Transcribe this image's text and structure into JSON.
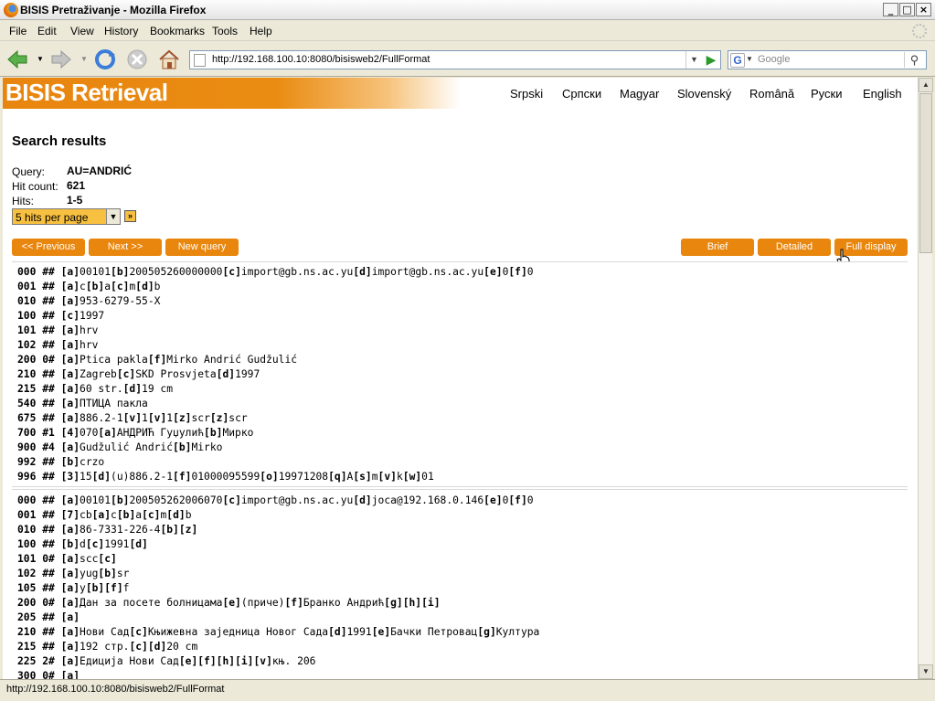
{
  "window": {
    "title": "BISIS Pretraživanje - Mozilla Firefox"
  },
  "menu": [
    "File",
    "Edit",
    "View",
    "History",
    "Bookmarks",
    "Tools",
    "Help"
  ],
  "address": {
    "url": "http://192.168.100.10:8080/bisisweb2/FullFormat"
  },
  "search": {
    "engine": "G",
    "placeholder": "Google"
  },
  "status": {
    "text": "http://192.168.100.10:8080/bisisweb2/FullFormat"
  },
  "site": {
    "logo": "BISIS Retrieval",
    "languages": [
      "Srpski",
      "Српски",
      "Magyar",
      "Slovenský",
      "Română",
      "Руски",
      "English"
    ]
  },
  "results": {
    "heading": "Search results",
    "query_label": "Query:",
    "query": "AU=ANDRIĆ",
    "hitcount_label": "Hit count:",
    "hitcount": "621",
    "hits_label": "Hits:",
    "hits": "1-5",
    "per_page": "5 hits per page"
  },
  "buttons": {
    "previous": "<< Previous",
    "next": "Next >>",
    "new_query": "New query",
    "brief": "Brief",
    "detailed": "Detailed",
    "full": "Full display"
  },
  "records": [
    [
      [
        "000 ##",
        "[a]00101[b]200505260000000[c]import@gb.ns.ac.yu[d]import@gb.ns.ac.yu[e]0[f]0"
      ],
      [
        "001 ##",
        "[a]c[b]a[c]m[d]b"
      ],
      [
        "010 ##",
        "[a]953-6279-55-X"
      ],
      [
        "100 ##",
        "[c]1997"
      ],
      [
        "101 ##",
        "[a]hrv"
      ],
      [
        "102 ##",
        "[a]hrv"
      ],
      [
        "200 0#",
        "[a]Ptica pakla[f]Mirko Andrić Gudžulić"
      ],
      [
        "210 ##",
        "[a]Zagreb[c]SKD Prosvjeta[d]1997"
      ],
      [
        "215 ##",
        "[a]60 str.[d]19 cm"
      ],
      [
        "540 ##",
        "[a]ПТИЦА пакла"
      ],
      [
        "675 ##",
        "[a]886.2-1[v]1[v]1[z]scr[z]scr"
      ],
      [
        "700 #1",
        "[4]070[a]АНДРИЋ Гуџулић[b]Мирко"
      ],
      [
        "900 #4",
        "[a]Gudžulić Andrić[b]Mirko"
      ],
      [
        "992 ##",
        "[b]crzo"
      ],
      [
        "996 ##",
        "[3]15[d](u)886.2-1[f]01000095599[o]19971208[q]A[s]m[v]k[w]01"
      ]
    ],
    [
      [
        "000 ##",
        "[a]00101[b]200505262006070[c]import@gb.ns.ac.yu[d]joca@192.168.0.146[e]0[f]0"
      ],
      [
        "001 ##",
        "[7]cb[a]c[b]a[c]m[d]b"
      ],
      [
        "010 ##",
        "[a]86-7331-226-4[b][z]"
      ],
      [
        "100 ##",
        "[b]d[c]1991[d]"
      ],
      [
        "101 0#",
        "[a]scc[c]"
      ],
      [
        "102 ##",
        "[a]yug[b]sr"
      ],
      [
        "105 ##",
        "[a]y[b][f]f"
      ],
      [
        "200 0#",
        "[a]Дан за посете болницама[e](приче)[f]Бранко Андрић[g][h][i]"
      ],
      [
        "205 ##",
        "[a]"
      ],
      [
        "210 ##",
        "[a]Нови Сад[c]Књижевна заједница Новог Сада[d]1991[e]Бачки Петровац[g]Култура"
      ],
      [
        "215 ##",
        "[a]192 стр.[c][d]20 cm"
      ],
      [
        "225 2#",
        "[a]Едиција Нови Сад[e][f][h][i][v]књ. 206"
      ],
      [
        "300 0#",
        "[a]"
      ]
    ]
  ]
}
